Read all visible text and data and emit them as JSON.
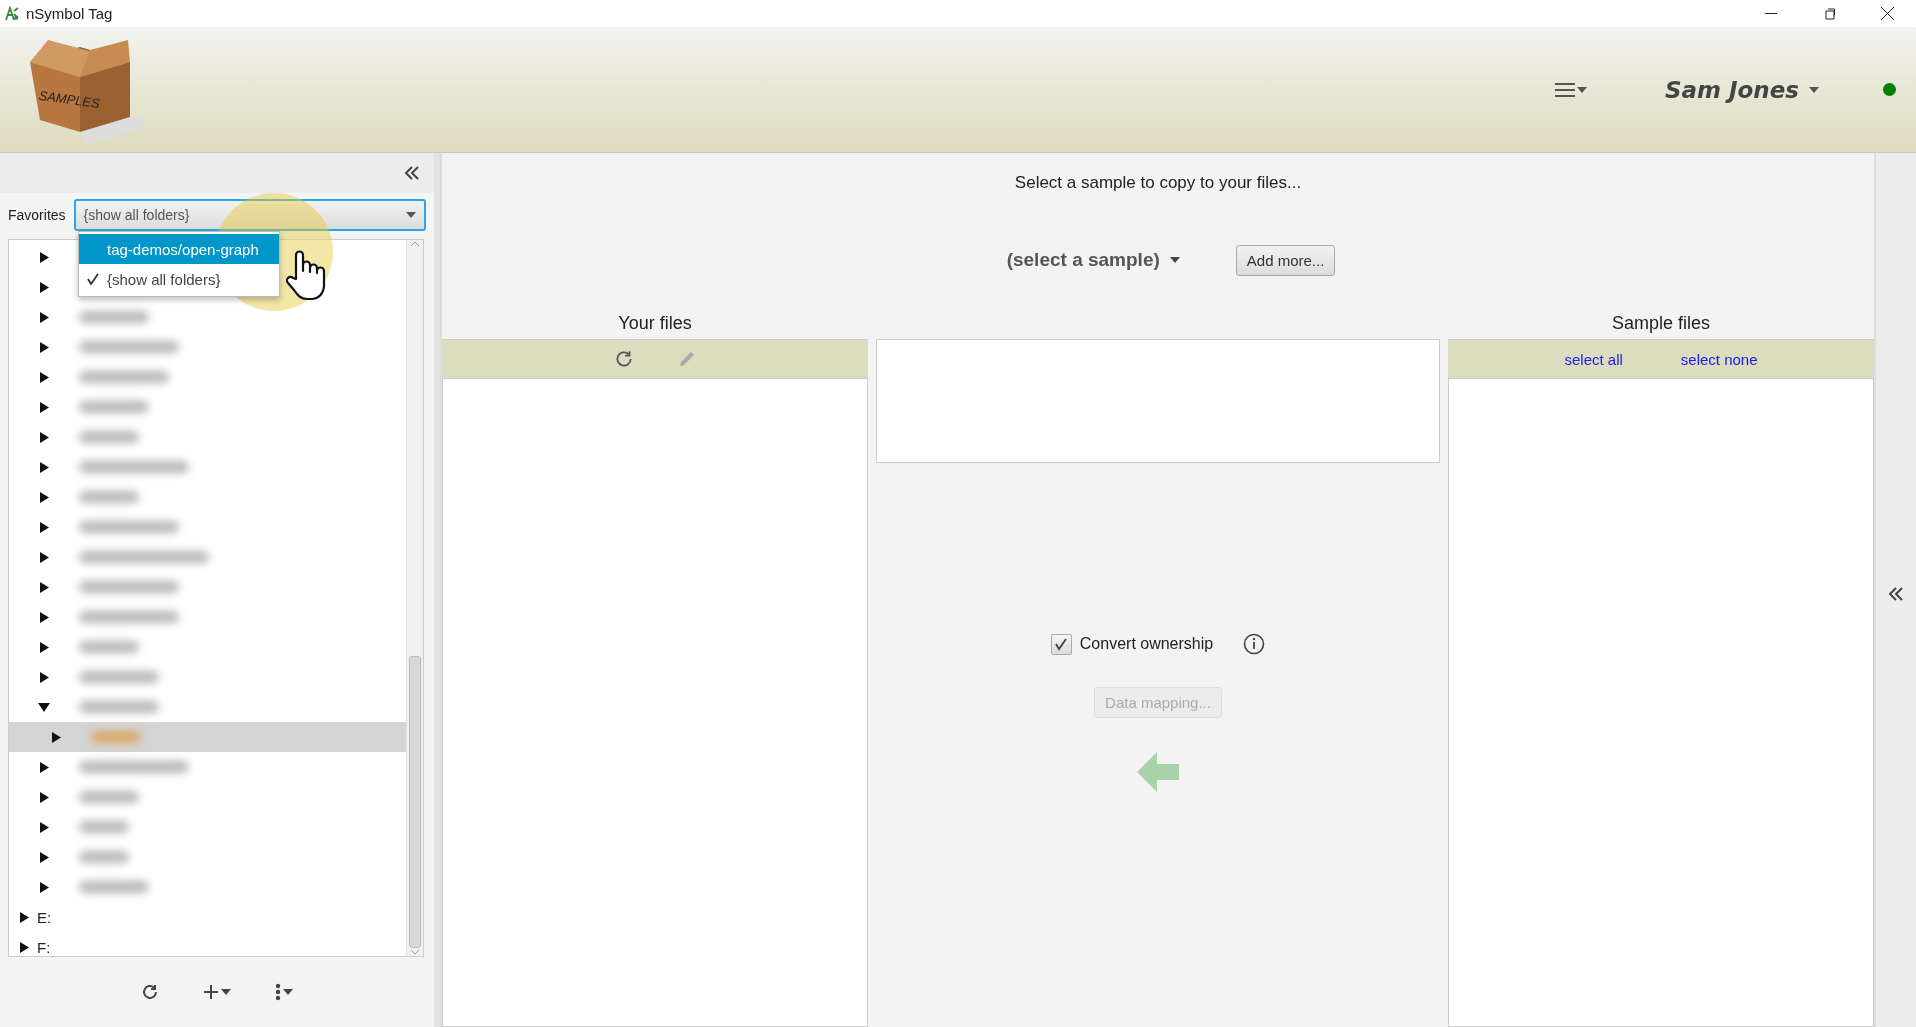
{
  "window": {
    "title": "nSymbol Tag"
  },
  "header": {
    "logo_text": "SAMPLES",
    "user": "Sam Jones",
    "online": true
  },
  "sidebar": {
    "favorites_label": "Favorites",
    "favorites_value": "{show all folders}",
    "favorites_options": [
      {
        "label": "tag-demos/open-graph",
        "highlighted": true,
        "checked": false
      },
      {
        "label": "{show all folders}",
        "highlighted": false,
        "checked": true
      }
    ],
    "folders": [
      {
        "expanded": false,
        "selected": false
      },
      {
        "expanded": false,
        "selected": false
      },
      {
        "expanded": false,
        "selected": false
      },
      {
        "expanded": false,
        "selected": false
      },
      {
        "expanded": false,
        "selected": false
      },
      {
        "expanded": false,
        "selected": false
      },
      {
        "expanded": false,
        "selected": false
      },
      {
        "expanded": false,
        "selected": false
      },
      {
        "expanded": false,
        "selected": false
      },
      {
        "expanded": false,
        "selected": false
      },
      {
        "expanded": false,
        "selected": false
      },
      {
        "expanded": false,
        "selected": false
      },
      {
        "expanded": false,
        "selected": false
      },
      {
        "expanded": false,
        "selected": false
      },
      {
        "expanded": false,
        "selected": false
      },
      {
        "expanded": true,
        "selected": false,
        "children": [
          {
            "expanded": false,
            "selected": true
          }
        ]
      },
      {
        "expanded": false,
        "selected": false
      },
      {
        "expanded": false,
        "selected": false
      },
      {
        "expanded": false,
        "selected": false
      },
      {
        "expanded": false,
        "selected": false
      },
      {
        "expanded": false,
        "selected": false
      }
    ],
    "drives": [
      {
        "label": "E:",
        "expanded": false
      },
      {
        "label": "F:",
        "expanded": false
      }
    ]
  },
  "main": {
    "prompt": "Select a sample to copy to your files...",
    "sample_select": "(select a sample)",
    "add_button": "Add more...",
    "your_files": {
      "title": "Your files"
    },
    "sample_files": {
      "title": "Sample files",
      "actions": [
        "select all",
        "select none"
      ]
    },
    "convert_ownership": {
      "label": "Convert ownership",
      "checked": true
    },
    "data_mapping": {
      "label": "Data mapping...",
      "disabled": true
    }
  }
}
